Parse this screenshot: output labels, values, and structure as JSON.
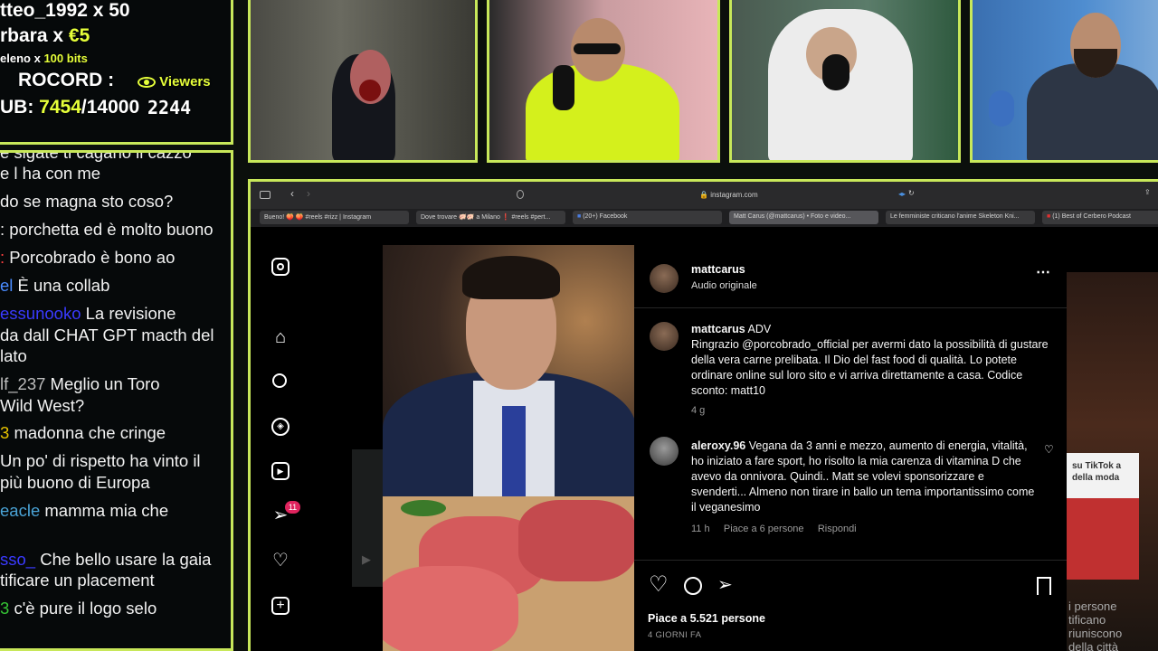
{
  "overlay": {
    "donations": [
      {
        "user": "tteo_1992",
        "amount": "x 50"
      },
      {
        "user": "rbara",
        "amount": "x",
        "money": "€5"
      },
      {
        "user": "eleno",
        "amount": "x",
        "bits": "100 bits"
      }
    ],
    "record_label": "ROCORD :",
    "viewers_label": "Viewers",
    "viewers_count": "2244",
    "sub_label": "UB:",
    "sub_current": "7454",
    "sub_goal": "/14000",
    "colors": {
      "accent": "#c8e85a",
      "highlight": "#e6ff3a"
    }
  },
  "chat": [
    {
      "user": "",
      "text": "e sigate ti cagano il cazzo",
      "user_color": "#ffffff"
    },
    {
      "user": "",
      "text": "e l ha con me",
      "user_color": "#ffffff"
    },
    {
      "user": "",
      "text": "do se magna sto coso?",
      "user_color": "#ffffff"
    },
    {
      "user": "",
      "text": "porchetta ed è molto buono",
      "user_color": "#ffffff"
    },
    {
      "user": ":",
      "text": "Porcobrado è bono ao",
      "user_color": "#ff4040"
    },
    {
      "user": "el",
      "text": "È una collab",
      "user_color": "#4a8cff"
    },
    {
      "user": "essunooko",
      "text": "La revisione",
      "user_color": "#3a3aff"
    },
    {
      "user": "",
      "text": "da dall CHAT GPT macth del",
      "user_color": "#ffffff"
    },
    {
      "user": "",
      "text": "lato",
      "user_color": "#ffffff"
    },
    {
      "user": "lf_237",
      "text": "Meglio un Toro",
      "user_color": "#bdbdbd"
    },
    {
      "user": "",
      "text": "Wild West?",
      "user_color": "#ffffff"
    },
    {
      "user": "3",
      "text": "madonna che cringe",
      "user_color": "#e6c200"
    },
    {
      "user": "",
      "text": "Un po' di rispetto ha vinto il",
      "user_color": "#ffffff"
    },
    {
      "user": "",
      "text": "più buono di Europa",
      "user_color": "#ffffff"
    },
    {
      "user": "eacle",
      "text": "mamma mia che",
      "user_color": "#4aa3d6"
    },
    {
      "user": "sso_",
      "text": "Che bello usare la gaia",
      "user_color": "#3a3aff"
    },
    {
      "user": "",
      "text": "tificare un placement",
      "user_color": "#ffffff"
    },
    {
      "user": "3",
      "text": "c'è pure il logo selo",
      "user_color": "#35c435"
    }
  ],
  "browser": {
    "url": "instagram.com",
    "tabs": [
      "Bueno! 🍑 🍑 #reels #rizz | Instagram",
      "Dove trovare 🐖🐖 a Milano ❗ #reels #pert...",
      "(20+) Facebook",
      "Matt Carus (@mattcarus) • Foto e video...",
      "Le femministe criticano l'anime Skeleton Kni...",
      "(1) Best of Cerbero Podcast"
    ]
  },
  "instagram": {
    "nav_icons": [
      "instagram-logo-icon",
      "home-icon",
      "search-icon",
      "explore-icon",
      "reels-icon",
      "messages-icon",
      "notifications-icon",
      "create-icon"
    ],
    "messages_badge": "11",
    "author": "mattcarus",
    "audio": "Audio originale",
    "caption": {
      "user": "mattcarus",
      "tag": "ADV",
      "text": "Ringrazio @porcobrado_official per avermi dato la possibilità di gustare della vera carne prelibata. Il Dio del fast food di qualità. Lo potete ordinare online sul loro sito e vi arriva direttamente a casa. Codice sconto: matt10",
      "time": "4 g"
    },
    "comment": {
      "user": "aleroxy.96",
      "text": "Vegana da 3 anni e mezzo, aumento di energia, vitalità, ho iniziato a fare sport, ho risolto la mia carenza di vitamina D che avevo da onnivora. Quindi.. Matt se volevi sponsorizzare e svenderti... Almeno non tirare in ballo un tema importantissimo come il veganesimo",
      "time": "11 h",
      "likes": "Piace a 6 persone",
      "reply": "Rispondi"
    },
    "likes": "Piace a 5.521 persone",
    "date": "4 GIORNI FA",
    "side_card": {
      "text1": "su TikTok a",
      "text2": "della moda",
      "bottom1": "i persone",
      "bottom2": "tificano",
      "bottom3": "riuniscono",
      "bottom4": "della città"
    }
  }
}
